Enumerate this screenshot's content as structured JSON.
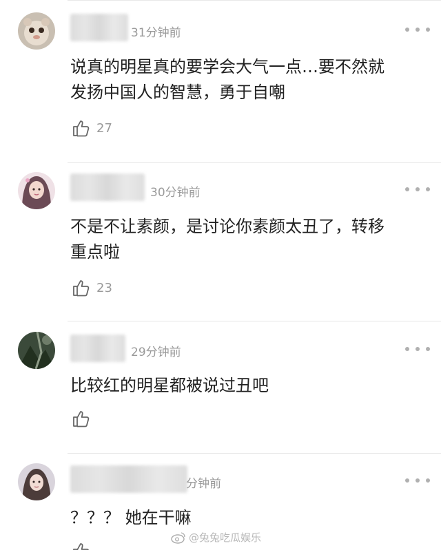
{
  "comments": [
    {
      "time": "31分钟前",
      "text_lines": [
        "说真的明星真的要学会大气一点…要不然就",
        "发扬中国人的智慧，勇于自嘲"
      ],
      "likes": "27"
    },
    {
      "time": "30分钟前",
      "text_lines": [
        "不是不让素颜，是讨论你素颜太丑了，转移",
        "重点啦"
      ],
      "likes": "23"
    },
    {
      "time": "29分钟前",
      "text_lines": [
        "比较红的明星都被说过丑吧"
      ],
      "likes": ""
    },
    {
      "time": "分钟前",
      "text_lines": [
        "？？？ 她在干嘛"
      ],
      "likes": ""
    }
  ],
  "watermark": "@兔兔吃瓜娱乐",
  "icons": {
    "like": "thumbs-up-icon",
    "more": "more-dots-icon",
    "watermark": "weibo-logo-icon"
  },
  "colors": {
    "text": "#222222",
    "meta": "#9a9a9a",
    "divider": "#e6e6e6"
  }
}
